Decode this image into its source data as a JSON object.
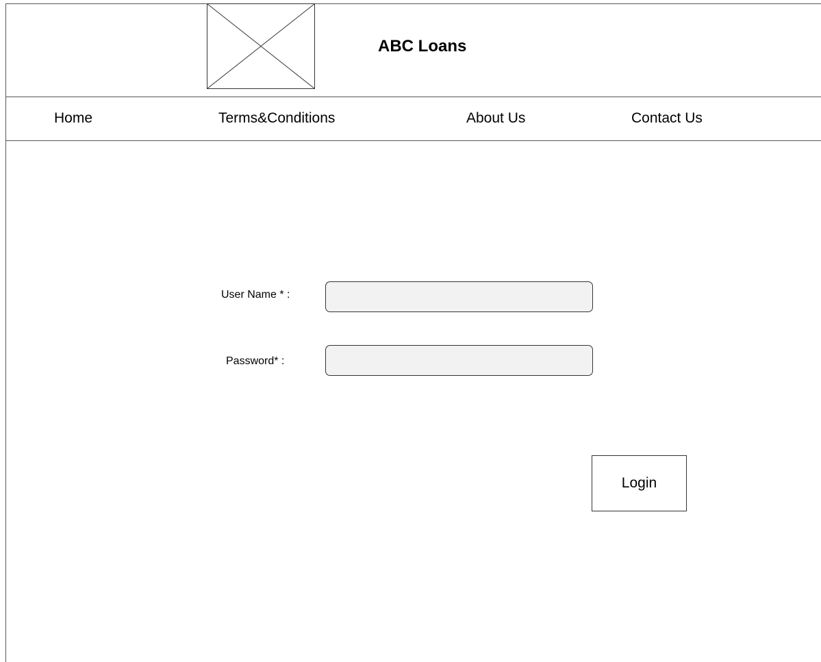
{
  "header": {
    "logo_icon": "image-placeholder-icon",
    "title": "ABC Loans"
  },
  "nav": {
    "items": [
      {
        "label": "Home"
      },
      {
        "label": "Terms&Conditions"
      },
      {
        "label": "About Us"
      },
      {
        "label": "Contact Us"
      }
    ]
  },
  "form": {
    "username_label": "User Name * :",
    "username_value": "",
    "password_label": "Password* :",
    "password_value": "",
    "login_label": "Login"
  },
  "colors": {
    "border": "#555555",
    "input_background": "#f2f2f2",
    "background": "#ffffff"
  }
}
